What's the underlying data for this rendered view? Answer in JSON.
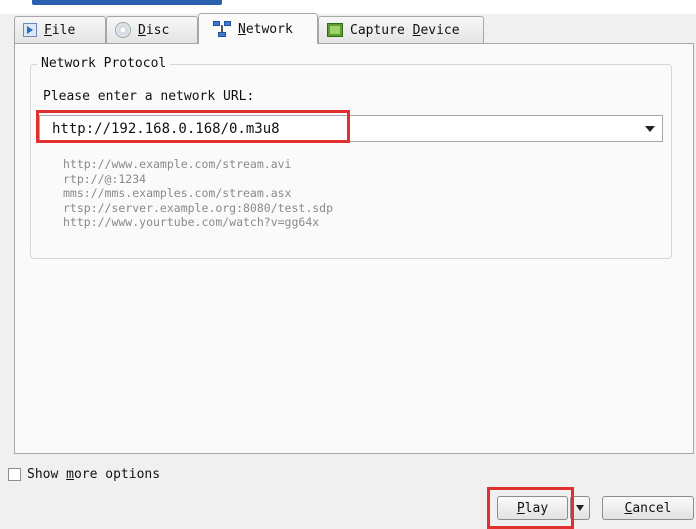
{
  "tabs": [
    {
      "id": "file",
      "accel": "F",
      "rest": "ile",
      "icon": "play-file-icon"
    },
    {
      "id": "disc",
      "accel": "D",
      "rest": "isc",
      "icon": "disc-icon"
    },
    {
      "id": "network",
      "accel": "N",
      "rest": "etwork",
      "icon": "network-icon",
      "active": true
    },
    {
      "id": "capture",
      "pre": "Capture ",
      "accel": "D",
      "rest": "evice",
      "icon": "capture-device-icon"
    }
  ],
  "network": {
    "group_title": "Network Protocol",
    "prompt": "Please enter a network URL:",
    "url_value": "http://192.168.0.168/0.m3u8",
    "examples": [
      "http://www.example.com/stream.avi",
      "rtp://@:1234",
      "mms://mms.examples.com/stream.asx",
      "rtsp://server.example.org:8080/test.sdp",
      "http://www.yourtube.com/watch?v=gg64x"
    ]
  },
  "options": {
    "pre": "Show ",
    "accel": "m",
    "rest": "ore options",
    "checked": false
  },
  "buttons": {
    "play": {
      "accel": "P",
      "rest": "lay"
    },
    "cancel": {
      "accel": "C",
      "rest": "ancel"
    }
  },
  "highlight_color": "#e03030"
}
